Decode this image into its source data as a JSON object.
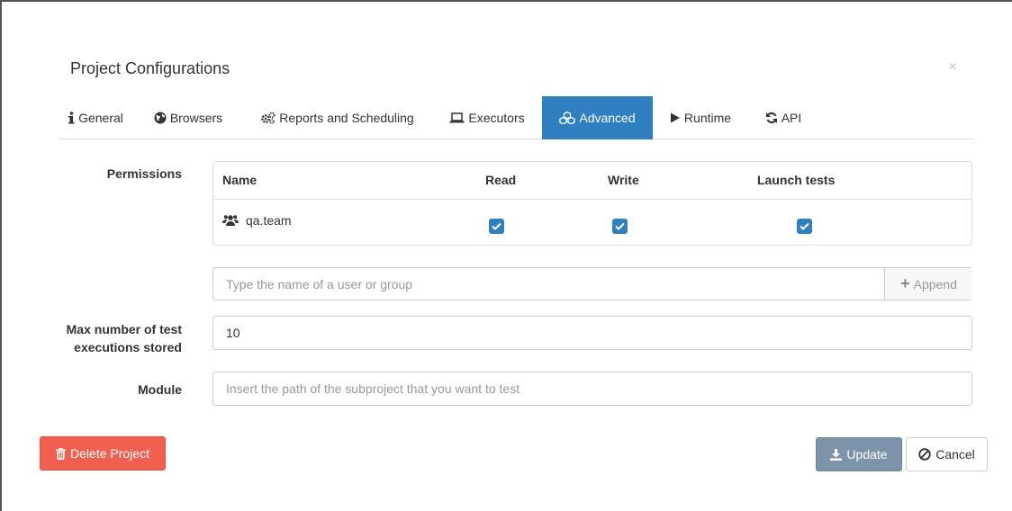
{
  "modal": {
    "title": "Project Configurations",
    "close_symbol": "×"
  },
  "tabs": [
    {
      "label": "General",
      "icon": "info-icon",
      "active": false
    },
    {
      "label": "Browsers",
      "icon": "globe-icon",
      "active": false
    },
    {
      "label": "Reports and Scheduling",
      "icon": "gears-icon",
      "active": false
    },
    {
      "label": "Executors",
      "icon": "laptop-icon",
      "active": false
    },
    {
      "label": "Advanced",
      "icon": "cubes-icon",
      "active": true
    },
    {
      "label": "Runtime",
      "icon": "play-icon",
      "active": false
    },
    {
      "label": "API",
      "icon": "refresh-icon",
      "active": false
    }
  ],
  "permissions": {
    "label": "Permissions",
    "columns": [
      "Name",
      "Read",
      "Write",
      "Launch tests"
    ],
    "rows": [
      {
        "name": "qa.team",
        "icon": "users-icon",
        "read": true,
        "write": true,
        "launch": true
      }
    ],
    "add_placeholder": "Type the name of a user or group",
    "append_label": "Append"
  },
  "max_executions": {
    "label_line1": "Max number of test",
    "label_line2": "executions stored",
    "value": "10"
  },
  "module": {
    "label": "Module",
    "placeholder": "Insert the path of the subproject that you want to test",
    "value": ""
  },
  "buttons": {
    "delete": "Delete Project",
    "update": "Update",
    "cancel": "Cancel"
  },
  "colors": {
    "accent": "#2f7fc1",
    "danger": "#f05f4f",
    "update": "#7d93a9"
  }
}
